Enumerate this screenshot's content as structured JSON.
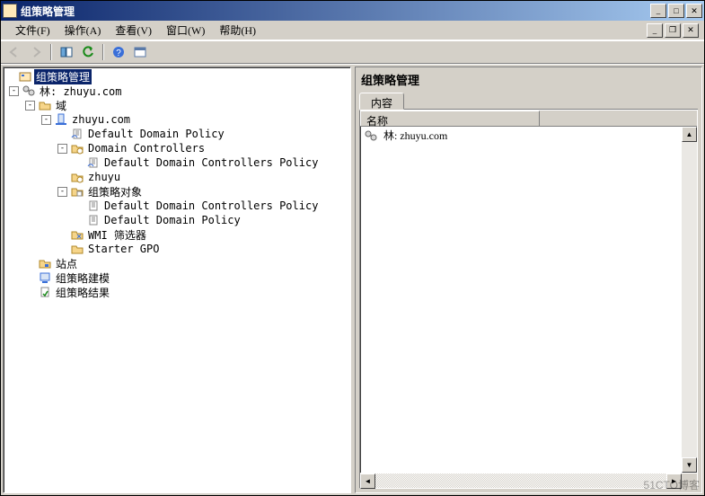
{
  "window": {
    "title": "组策略管理"
  },
  "menu": {
    "file": "文件(F)",
    "action": "操作(A)",
    "view": "查看(V)",
    "window": "窗口(W)",
    "help": "帮助(H)"
  },
  "toolbar_icons": {
    "back": "back-arrow-icon",
    "forward": "forward-arrow-icon",
    "show_hide": "panel-toggle-icon",
    "refresh": "refresh-icon",
    "help": "help-icon",
    "properties": "properties-icon"
  },
  "tree": {
    "root": "组策略管理",
    "forest": "林: zhuyu.com",
    "domains": "域",
    "domain": "zhuyu.com",
    "ddp": "Default Domain Policy",
    "dc_ou": "Domain Controllers",
    "ddcp": "Default Domain Controllers Policy",
    "zhuyu_ou": "zhuyu",
    "gpo_container": "组策略对象",
    "gpo_ddcp": "Default Domain Controllers Policy",
    "gpo_ddp": "Default Domain Policy",
    "wmi": "WMI 筛选器",
    "starter": "Starter GPO",
    "sites": "站点",
    "modeling": "组策略建模",
    "results": "组策略结果"
  },
  "right": {
    "title": "组策略管理",
    "tab_content": "内容",
    "column_name": "名称",
    "rows": [
      {
        "label": "林: zhuyu.com"
      }
    ]
  },
  "watermark": "51CTO博客"
}
